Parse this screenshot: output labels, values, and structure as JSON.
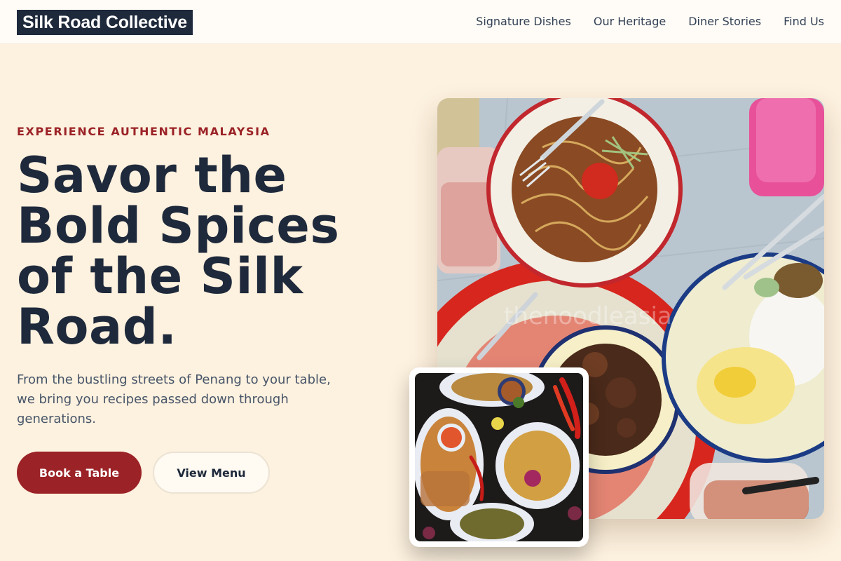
{
  "header": {
    "logo": "Silk Road Collective",
    "nav": [
      "Signature Dishes",
      "Our Heritage",
      "Diner Stories",
      "Find Us"
    ]
  },
  "hero": {
    "eyebrow": "EXPERIENCE AUTHENTIC MALAYSIA",
    "headline_lines": [
      "Savor the",
      "Bold Spices",
      "of the Silk",
      "Road."
    ],
    "lead": "From the bustling streets of Penang to your table, we bring you recipes passed down through generations.",
    "primary_cta": "Book a Table",
    "secondary_cta": "View Menu"
  },
  "images": {
    "main_icon": "food-photo-icon",
    "inset_icon": "food-photo-icon",
    "watermark": "thenoodleasia"
  },
  "colors": {
    "accent": "#9b2226",
    "ink": "#1e293b",
    "background": "#fdf1df"
  }
}
